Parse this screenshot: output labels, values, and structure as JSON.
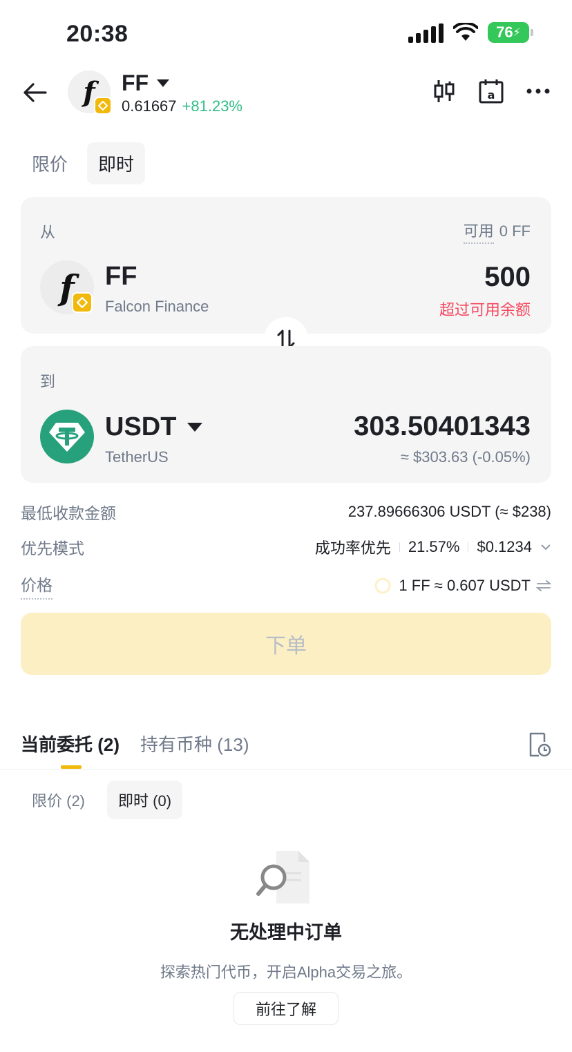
{
  "status_bar": {
    "time": "20:38",
    "battery": "76"
  },
  "header": {
    "symbol": "FF",
    "price": "0.61667",
    "change": "+81.23%"
  },
  "order_types": [
    {
      "label": "限价"
    },
    {
      "label": "即时"
    }
  ],
  "from": {
    "label": "从",
    "available_label": "可用",
    "available_value": "0 FF",
    "token_symbol": "FF",
    "token_name": "Falcon Finance",
    "amount": "500",
    "warning": "超过可用余额"
  },
  "to": {
    "label": "到",
    "token_symbol": "USDT",
    "token_name": "TetherUS",
    "amount": "303.50401343",
    "usd_value": "≈ $303.63 (-0.05%)"
  },
  "details": {
    "min_receive_label": "最低收款金额",
    "min_receive_value": "237.89666306 USDT (≈ $238)",
    "priority_label": "优先模式",
    "priority_mode": "成功率优先",
    "priority_pct": "21.57%",
    "priority_fee": "$0.1234",
    "price_label": "价格",
    "price_value": "1 FF ≈ 0.607 USDT"
  },
  "submit_label": "下单",
  "list_tabs": [
    {
      "label": "当前委托 (2)"
    },
    {
      "label": "持有币种 (13)"
    }
  ],
  "sub_tabs": [
    {
      "label": "限价 (2)"
    },
    {
      "label": "即时 (0)"
    }
  ],
  "empty_state": {
    "title": "无处理中订单",
    "description": "探索热门代币，开启Alpha交易之旅。",
    "button": "前往了解"
  },
  "colors": {
    "accent": "#f0b90b",
    "up": "#2ebd85",
    "down": "#f6465d",
    "usdt": "#26a17b"
  }
}
